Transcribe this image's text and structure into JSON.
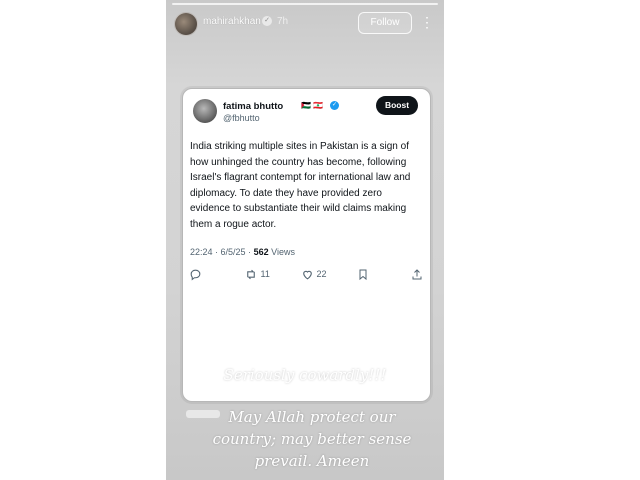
{
  "story": {
    "username": "mahirahkhan",
    "time": "7h",
    "follow_label": "Follow",
    "more_icon": "⋮",
    "caption_top": "Seriously cowardly!!!",
    "caption_bottom": "May Allah protect our country; may better sense prevail. Ameen"
  },
  "tweet": {
    "display_name": "fatima bhutto",
    "flags": "🇵🇸 🇱🇧",
    "handle": "@fbhutto",
    "boost_label": "Boost",
    "text": "India striking multiple sites in Pakistan is a sign of how unhinged the country has become, following Israel's flagrant contempt for international law and diplomacy. To date they have provided zero evidence to substantiate their wild claims making them a rogue actor.",
    "timestamp": "22:24 · 6/5/25 ·",
    "views_count": "562",
    "views_label": "Views",
    "replies": "",
    "retweets": "11",
    "likes": "22",
    "accent_color": "#1d9bf0"
  }
}
